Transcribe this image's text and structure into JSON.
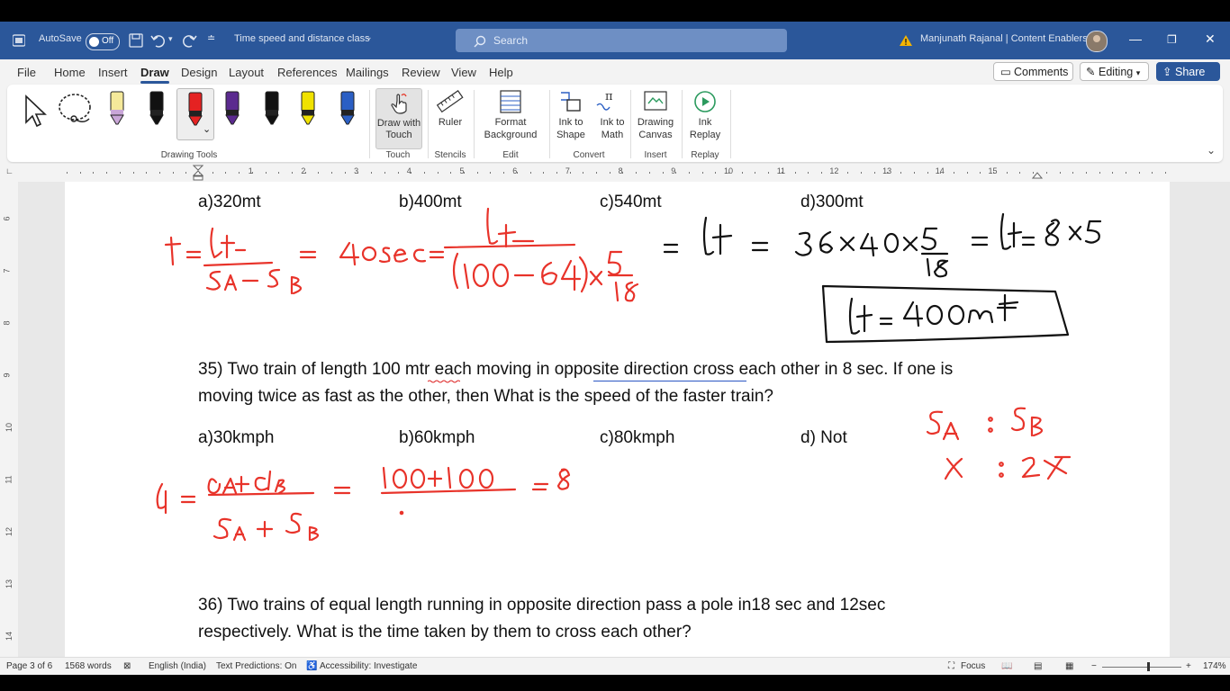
{
  "titlebar": {
    "autosave_label": "AutoSave",
    "autosave_state": "Off",
    "doc_title": "Time speed and distance class",
    "search_placeholder": "Search",
    "user": "Manjunath Rajanal | Content Enablers"
  },
  "ribbon_tabs": [
    "File",
    "Home",
    "Insert",
    "Draw",
    "Design",
    "Layout",
    "References",
    "Mailings",
    "Review",
    "View",
    "Help"
  ],
  "active_tab": "Draw",
  "right_buttons": {
    "comments": "Comments",
    "editing": "Editing",
    "share": "Share"
  },
  "ribbon": {
    "groups": {
      "drawing_tools": "Drawing Tools",
      "touch": "Touch",
      "stencils": "Stencils",
      "edit": "Edit",
      "convert": "Convert",
      "insert": "Insert",
      "replay": "Replay"
    },
    "buttons": {
      "draw_with_touch_1": "Draw with",
      "draw_with_touch_2": "Touch",
      "ruler": "Ruler",
      "format_bg_1": "Format",
      "format_bg_2": "Background",
      "ink_to_shape_1": "Ink to",
      "ink_to_shape_2": "Shape",
      "ink_to_math_1": "Ink to",
      "ink_to_math_2": "Math",
      "drawing_canvas_1": "Drawing",
      "drawing_canvas_2": "Canvas",
      "ink_replay_1": "Ink",
      "ink_replay_2": "Replay"
    },
    "pen_colors": [
      "#f5e99a",
      "#111111",
      "#e52222",
      "#5b2a8f",
      "#111111",
      "#f0e200",
      "#2b5fc4"
    ]
  },
  "ruler_numbers": [
    "1",
    "2",
    "3",
    "4",
    "5",
    "6",
    "7",
    "8",
    "9",
    "10",
    "11",
    "12",
    "13",
    "14",
    "15"
  ],
  "vruler_numbers": [
    "6",
    "7",
    "8",
    "9",
    "10",
    "11",
    "12",
    "13",
    "14"
  ],
  "document": {
    "q34_options": [
      "a)320mt",
      "b)400mt",
      "c)540mt",
      "d)300mt"
    ],
    "q35_line1": "35) Two train of length 100 mtr each moving in opposite direction cross each other in 8 sec. If one is",
    "q35_line2": "moving twice as fast as the other, then What is the speed of the faster train?",
    "q35_options": [
      "a)30kmph",
      "b)60kmph",
      "c)80kmph",
      "d) Not"
    ],
    "q36_line1": "36) Two trains of equal length running in opposite direction pass a pole in18 sec and 12sec",
    "q36_line2": "respectively. What is the time taken by them to cross each other?"
  },
  "statusbar": {
    "page": "Page 3 of 6",
    "words": "1568 words",
    "language": "English (India)",
    "text_predictions": "Text Predictions: On",
    "accessibility": "Accessibility: Investigate",
    "focus": "Focus",
    "zoom": "174%"
  }
}
